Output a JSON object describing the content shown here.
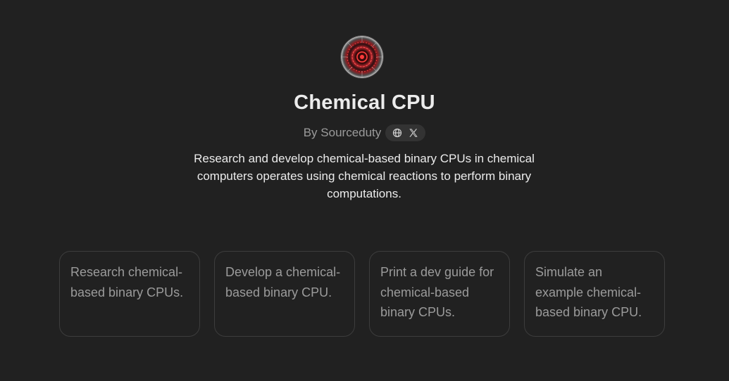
{
  "gpt": {
    "name": "Chemical CPU",
    "author": "By Sourceduty",
    "description": "Research and develop chemical-based binary CPUs in chemical computers operates using chemical reactions to perform binary computations.",
    "icons": [
      "globe-icon",
      "x-logo-icon"
    ]
  },
  "starters": [
    {
      "text": "Research chemical-based binary CPUs."
    },
    {
      "text": "Develop a chemical-based binary CPU."
    },
    {
      "text": "Print a dev guide for chemical-based binary CPUs."
    },
    {
      "text": "Simulate an example chemical-based binary CPU."
    }
  ],
  "colors": {
    "background": "#212121",
    "text": "#ececec",
    "muted": "#9b9b9b",
    "card_border": "#3d3d3d",
    "pill_bg": "#333333"
  }
}
